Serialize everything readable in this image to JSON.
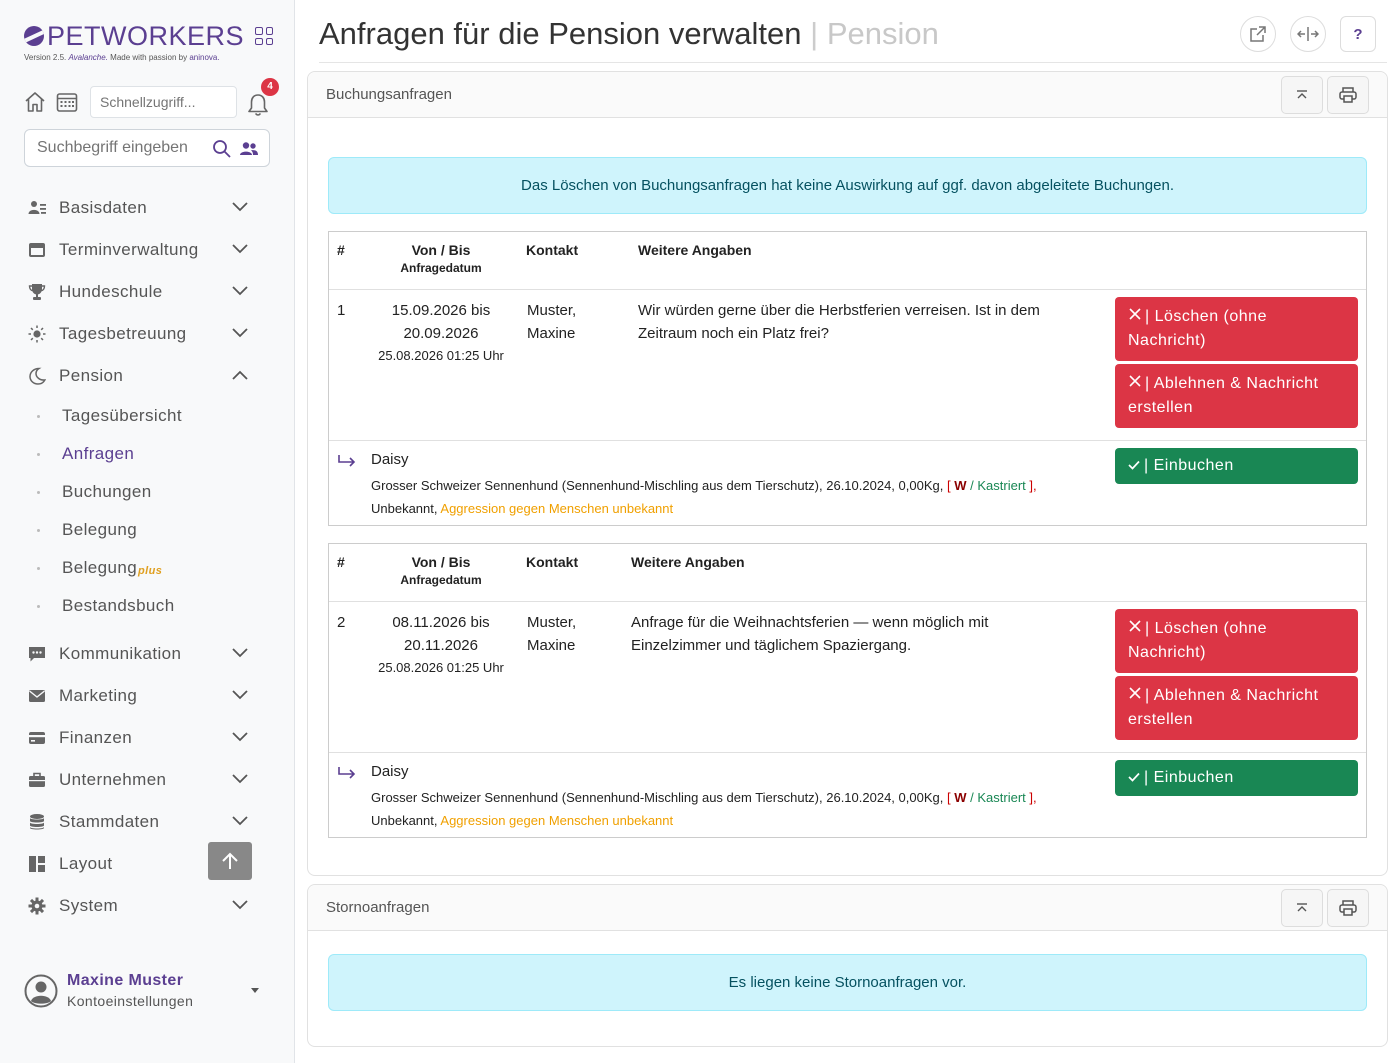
{
  "brand": {
    "name": "PETWORKERS",
    "version_prefix": "Version 2.5.",
    "version_name": "Avalanche.",
    "made_with": "Made with passion by",
    "company": "aninova."
  },
  "quick": {
    "placeholder": "Schnellzugriff...",
    "badge": "4"
  },
  "search": {
    "placeholder": "Suchbegriff eingeben"
  },
  "nav": {
    "basisdaten": "Basisdaten",
    "terminverwaltung": "Terminverwaltung",
    "hundeschule": "Hundeschule",
    "tagesbetreuung": "Tagesbetreuung",
    "pension": "Pension",
    "pension_sub": {
      "tagesuebersicht": "Tagesübersicht",
      "anfragen": "Anfragen",
      "buchungen": "Buchungen",
      "belegung": "Belegung",
      "belegung_plus": "Belegung",
      "plus": "plus",
      "bestandsbuch": "Bestandsbuch"
    },
    "kommunikation": "Kommunikation",
    "marketing": "Marketing",
    "finanzen": "Finanzen",
    "unternehmen": "Unternehmen",
    "stammdaten": "Stammdaten",
    "layout": "Layout",
    "system": "System"
  },
  "user": {
    "name": "Maxine Muster",
    "settings": "Kontoeinstellungen"
  },
  "page": {
    "title": "Anfragen für die Pension verwalten",
    "separator": "|",
    "context": "Pension",
    "help": "?"
  },
  "booking": {
    "title": "Buchungsanfragen",
    "alert": "Das Löschen von Buchungsanfragen hat keine Auswirkung auf ggf. davon abgeleitete Buchungen.",
    "headers": {
      "num": "#",
      "range": "Von / Bis",
      "request_date": "Anfragedatum",
      "contact": "Kontakt",
      "details": "Weitere Angaben"
    },
    "requests": [
      {
        "num": "1",
        "from": "15.09.2026 bis",
        "to": "20.09.2026",
        "date": "25.08.2026 01:25 Uhr",
        "contact1": "Muster,",
        "contact2": "Maxine",
        "text": "Wir würden gerne über die Herbstferien verreisen. Ist in dem Zeitraum noch ein Platz frei?",
        "btn_delete1": "| Löschen (ohne",
        "btn_delete2": "Nachricht)",
        "btn_reject1": "| Ablehnen & Nachricht",
        "btn_reject2": "erstellen",
        "btn_book": "| Einbuchen",
        "pet_name": "Daisy",
        "pet_desc": "Grosser Schweizer Sennenhund (Sennenhund-Mischling aus dem Tierschutz), 26.10.2024, 0,00Kg,",
        "bracket_open": "[",
        "sex": "W",
        "slash": "/",
        "castrated": "Kastriert",
        "bracket_close": "],",
        "unknown": "Unbekannt,",
        "aggression": "Aggression gegen Menschen unbekannt"
      },
      {
        "num": "2",
        "from": "08.11.2026 bis",
        "to": "20.11.2026",
        "date": "25.08.2026 01:25 Uhr",
        "contact1": "Muster,",
        "contact2": "Maxine",
        "text": "Anfrage für die Weihnachtsferien — wenn möglich mit Einzelzimmer und täglichem Spaziergang.",
        "btn_delete1": "| Löschen (ohne",
        "btn_delete2": "Nachricht)",
        "btn_reject1": "| Ablehnen & Nachricht",
        "btn_reject2": "erstellen",
        "btn_book": "| Einbuchen",
        "pet_name": "Daisy",
        "pet_desc": "Grosser Schweizer Sennenhund (Sennenhund-Mischling aus dem Tierschutz), 26.10.2024, 0,00Kg,",
        "bracket_open": "[",
        "sex": "W",
        "slash": "/",
        "castrated": "Kastriert",
        "bracket_close": "],",
        "unknown": "Unbekannt,",
        "aggression": "Aggression gegen Menschen unbekannt"
      }
    ]
  },
  "storno": {
    "title": "Stornoanfragen",
    "alert": "Es liegen keine Stornoanfragen vor."
  },
  "colors": {
    "brand": "#5b3f91",
    "danger": "#dc3545",
    "success": "#198754",
    "info_bg": "#cff4fc"
  }
}
